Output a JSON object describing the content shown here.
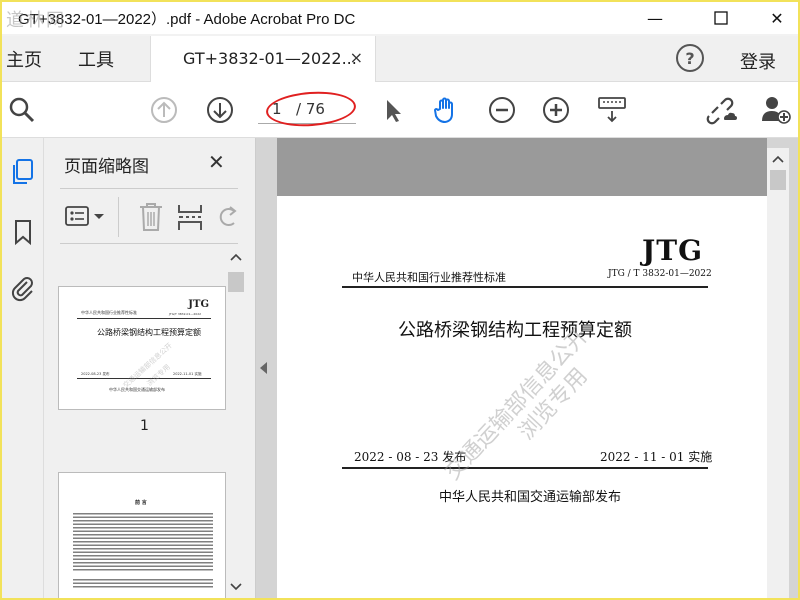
{
  "window": {
    "title": "GT+3832-01—2022）.pdf - Adobe Acrobat Pro DC",
    "corner_watermark": "道林网",
    "minimize": "—",
    "maximize": "☐",
    "close": "✕"
  },
  "tabs": {
    "home": "主页",
    "tools": "工具",
    "document_tab": "GT+3832-01—2022...",
    "document_tab_close": "×",
    "help": "?",
    "login": "登录"
  },
  "toolbar": {
    "page_current": "1",
    "page_total": "/ 76",
    "icons": [
      "search-icon",
      "page-up-icon",
      "page-down-icon",
      "select-cursor-icon",
      "hand-tool-icon",
      "zoom-out-icon",
      "zoom-in-icon",
      "keyboard-icon",
      "share-link-icon",
      "add-user-icon"
    ],
    "accent_color": "#1473e6",
    "annotation_color": "#e02020"
  },
  "thumbnail_pane": {
    "title": "页面缩略图",
    "close": "✕",
    "page1_label": "1",
    "thumb1": {
      "jtg": "JTG",
      "standard_line": "中华人民共和国行业推荐性标准",
      "code": "JTG/T 3832-01—2022",
      "title": "公路桥梁钢结构工程预算定额",
      "issued": "2022-08-23 发布",
      "implemented": "2022-11-01 实施",
      "publisher": "中华人民共和国交通运输部发布"
    },
    "thumb2": {
      "heading": "前  言"
    }
  },
  "document": {
    "jtg": "JTG",
    "standard_line": "中华人民共和国行业推荐性标准",
    "code": "JTG / T 3832-01—2022",
    "title": "公路桥梁钢结构工程预算定额",
    "issued": "2022 - 08 - 23  发布",
    "implemented": "2022 - 11 - 01  实施",
    "publisher": "中华人民共和国交通运输部发布",
    "watermark_line1": "交通运输部信息公开",
    "watermark_line2": "浏览专用"
  }
}
